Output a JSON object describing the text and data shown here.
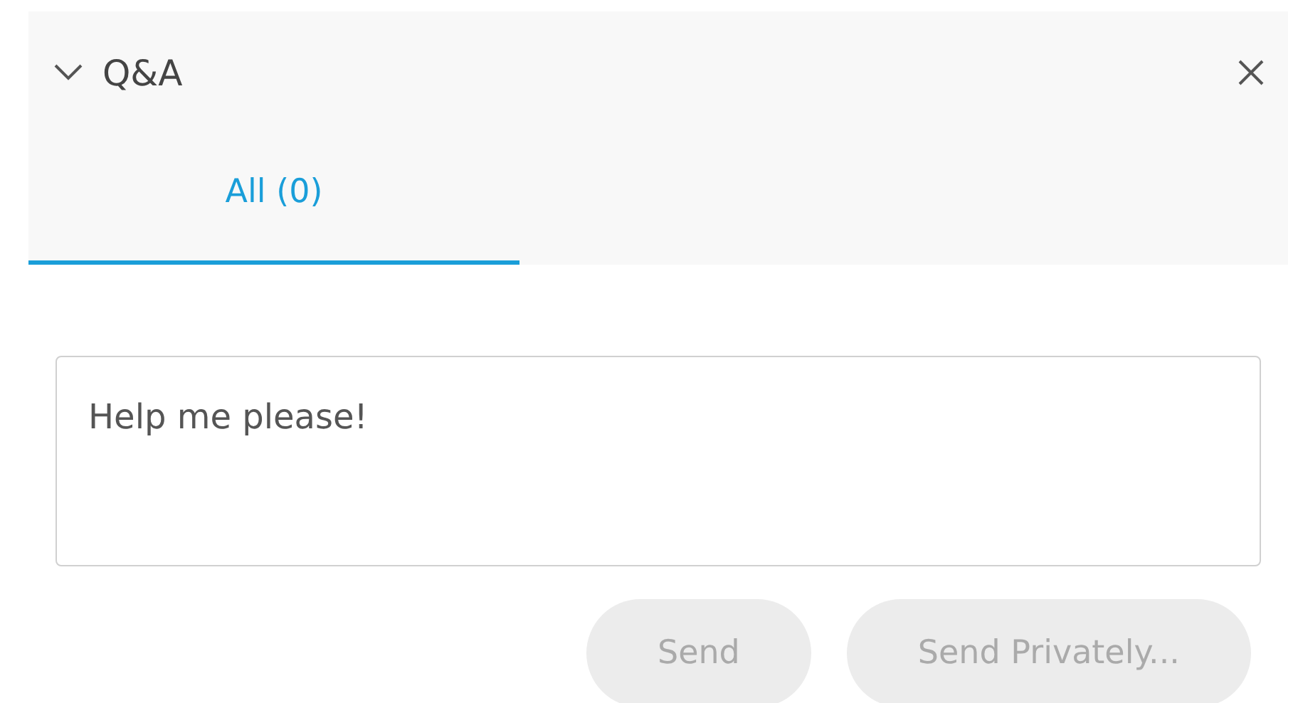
{
  "panel": {
    "title": "Q&A",
    "expanded": true
  },
  "tabs": [
    {
      "label": "All (0)",
      "selected": true
    }
  ],
  "question": {
    "value": "Help me please!"
  },
  "buttons": [
    {
      "label": "Send",
      "disabled": true
    },
    {
      "label": "Send Privately...",
      "disabled": true
    }
  ]
}
